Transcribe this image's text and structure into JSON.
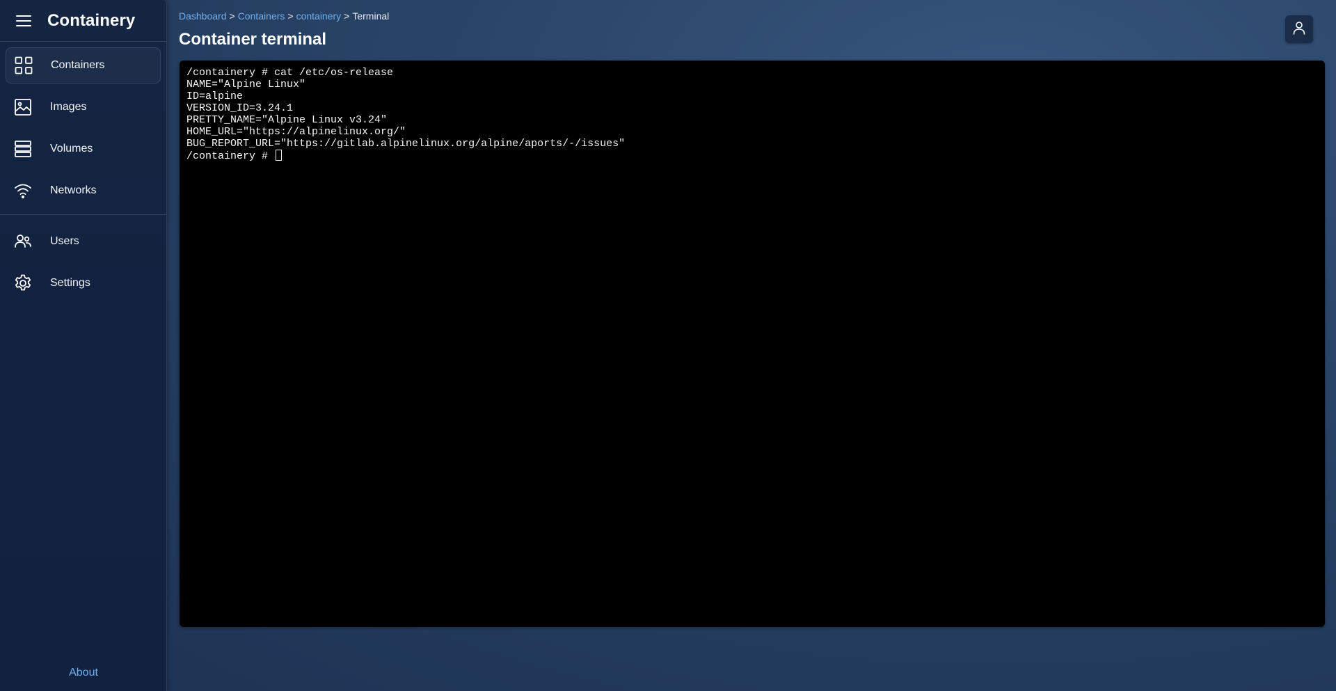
{
  "app": {
    "title": "Containery"
  },
  "sidebar": {
    "items": [
      {
        "label": "Containers",
        "icon": "grid-icon",
        "active": true
      },
      {
        "label": "Images",
        "icon": "image-icon"
      },
      {
        "label": "Volumes",
        "icon": "stack-icon"
      },
      {
        "label": "Networks",
        "icon": "wifi-icon"
      }
    ],
    "secondary_items": [
      {
        "label": "Users",
        "icon": "users-icon"
      },
      {
        "label": "Settings",
        "icon": "gear-icon"
      }
    ],
    "about_label": "About"
  },
  "breadcrumb": {
    "items": [
      "Dashboard",
      "Containers",
      "containery"
    ],
    "current": "Terminal",
    "separator": ">"
  },
  "page": {
    "title": "Container terminal"
  },
  "terminal": {
    "lines": [
      "/containery # cat /etc/os-release",
      "NAME=\"Alpine Linux\"",
      "ID=alpine",
      "VERSION_ID=3.24.1",
      "PRETTY_NAME=\"Alpine Linux v3.24\"",
      "HOME_URL=\"https://alpinelinux.org/\"",
      "BUG_REPORT_URL=\"https://gitlab.alpinelinux.org/alpine/aports/-/issues\""
    ],
    "prompt": "/containery # "
  },
  "colors": {
    "accent": "#6fb0ee",
    "sidebar_bg": "#132442",
    "terminal_bg": "#000000"
  }
}
